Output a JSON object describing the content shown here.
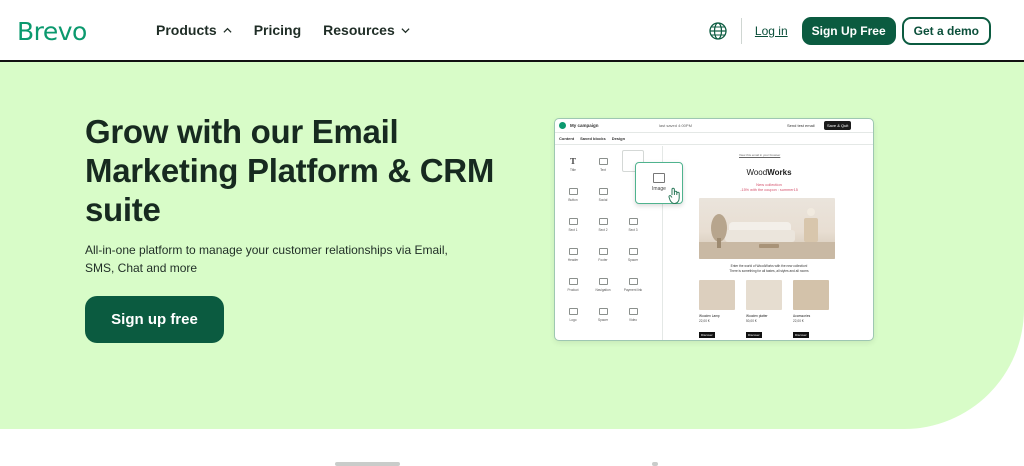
{
  "header": {
    "logo": "Brevo",
    "nav": [
      {
        "label": "Products",
        "icon": "chevron-up-icon"
      },
      {
        "label": "Pricing"
      },
      {
        "label": "Resources",
        "icon": "chevron-down-icon"
      }
    ],
    "login_label": "Log in",
    "signup_label": "Sign Up Free",
    "demo_label": "Get a demo",
    "globe_icon": "globe-icon"
  },
  "hero": {
    "title": "Grow with our Email Marketing Platform & CRM suite",
    "subtitle": "All-in-one platform to manage your customer relationships via Email, SMS, Chat and more",
    "cta_label": "Sign up free"
  },
  "editor": {
    "campaign_name": "My campaign",
    "saved_text": "last saved 4:00PM",
    "send_test": "Send test email",
    "save_quit": "Save & Quit",
    "tabs": [
      "Content",
      "Saved blocks",
      "Design"
    ],
    "blocks": [
      "Title",
      "Text",
      "Image",
      "Button",
      "Social",
      "Divider",
      "Sect 1",
      "Sect 2",
      "Sect 3",
      "Header",
      "Footer",
      "Spacer",
      "Product",
      "Navigation",
      "Payment link",
      "Logo",
      "Spacer",
      "Video"
    ],
    "drag_label": "Image",
    "email": {
      "view_online": "View this email in your browser",
      "brand_regular": "Wood",
      "brand_bold": "Works",
      "new_collection": "New collection",
      "promo": "-15% with the coupon : summer15",
      "desc_line1": "Enter the world of WoodWorks with the new collection!",
      "desc_line2": "There is something for all tastes, all styles and all rooms",
      "products": [
        {
          "name": "Wooden Lamp",
          "price": "22,00 €",
          "button": "Discover"
        },
        {
          "name": "Wooden platter",
          "price": "50,00 €",
          "button": "Discover"
        },
        {
          "name": "Accessories",
          "price": "22,00 €",
          "button": "Discover"
        }
      ]
    }
  },
  "colors": {
    "brand": "#0b996e",
    "button_dark": "#0b5b40",
    "hero_bg": "#d8fcc8",
    "promo": "#d4506b"
  }
}
